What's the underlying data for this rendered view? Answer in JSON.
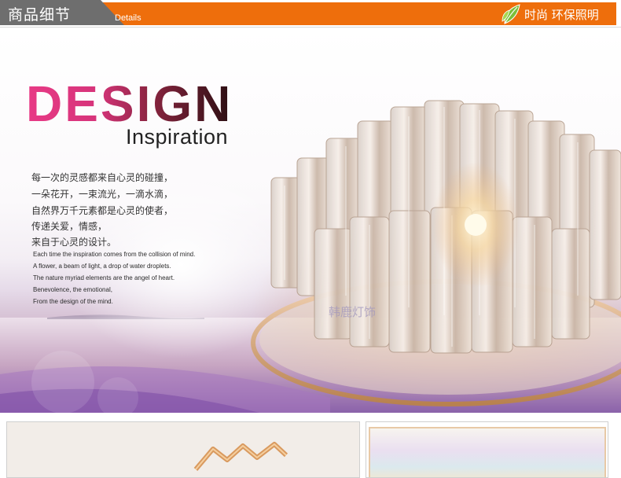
{
  "header": {
    "tab_title": "商品细节",
    "tab_subtitle": "Details",
    "slogan": "时尚 环保照明",
    "icon": "leaf-icon",
    "colors": {
      "bar": "#ee6e0c",
      "tab": "#6e6e6e"
    }
  },
  "hero": {
    "title": "DESIGN",
    "subtitle": "Inspiration",
    "cn_lines": [
      "每一次的灵感都来自心灵的碰撞，",
      "一朵花开，一束流光，一滴水滴，",
      "自然界万千元素都是心灵的使者，",
      "传递关爱，情感，",
      "来自于心灵的设计。"
    ],
    "en_lines": [
      "Each time the inspiration comes from the collision of mind.",
      "A flower, a beam of light, a drop of water droplets.",
      "The nature myriad elements are the angel of heart.",
      "Benevolence, the emotional,",
      "From the design of the mind."
    ],
    "watermark": "韩鹿灯饰",
    "title_gradient": [
      "#e83a86",
      "#2b0f12"
    ]
  }
}
